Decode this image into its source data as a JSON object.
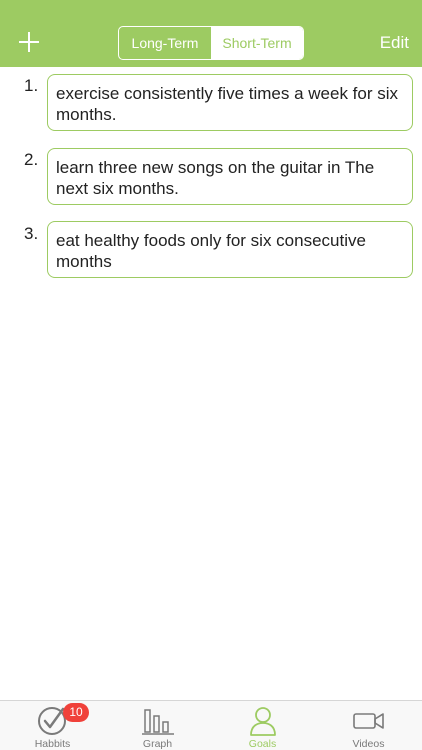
{
  "header": {
    "add_icon": "plus-icon",
    "segments": [
      {
        "label": "Long-Term",
        "selected": false
      },
      {
        "label": "Short-Term",
        "selected": true
      }
    ],
    "edit_label": "Edit",
    "color": "#9dcb62"
  },
  "goals": [
    {
      "number": "1.",
      "text": "exercise consistently five times a week for six months."
    },
    {
      "number": "2.",
      "text": "learn three new songs on the guitar in The next six months."
    },
    {
      "number": "3.",
      "text": "eat healthy foods only for six consecutive months"
    }
  ],
  "tabbar": {
    "tabs": [
      {
        "label": "Habbits",
        "icon": "check-circle-icon",
        "badge": "10",
        "active": false
      },
      {
        "label": "Graph",
        "icon": "bar-chart-icon",
        "active": false
      },
      {
        "label": "Goals",
        "icon": "person-icon",
        "active": true
      },
      {
        "label": "Videos",
        "icon": "video-camera-icon",
        "active": false
      }
    ]
  },
  "colors": {
    "accent": "#9dcb62",
    "badge": "#f0413a",
    "inactive": "#7a7a7a"
  }
}
